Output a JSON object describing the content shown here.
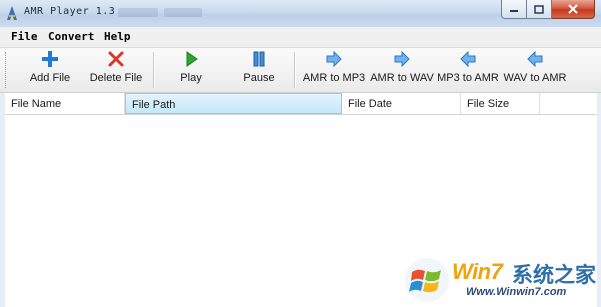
{
  "window": {
    "title": "AMR Player 1.3"
  },
  "menu": [
    "File",
    "Convert",
    "Help"
  ],
  "toolbar": {
    "add_file": "Add File",
    "delete_file": "Delete File",
    "play": "Play",
    "pause": "Pause",
    "amr_to_mp3": "AMR to MP3",
    "amr_to_wav": "AMR to WAV",
    "mp3_to_amr": "MP3 to AMR",
    "wav_to_amr": "WAV to AMR"
  },
  "columns": [
    "File Name",
    "File Path",
    "File Date",
    "File Size"
  ],
  "watermark": {
    "brand": "Win7",
    "brand_cn": "系统之家",
    "url": "Www.Winwin7.com"
  },
  "colors": {
    "titlebar": "#c9d9ec",
    "close": "#c5381c",
    "accent_blue": "#1f7bd6",
    "play_green": "#2ea52e",
    "delete_red": "#d43a2a"
  }
}
